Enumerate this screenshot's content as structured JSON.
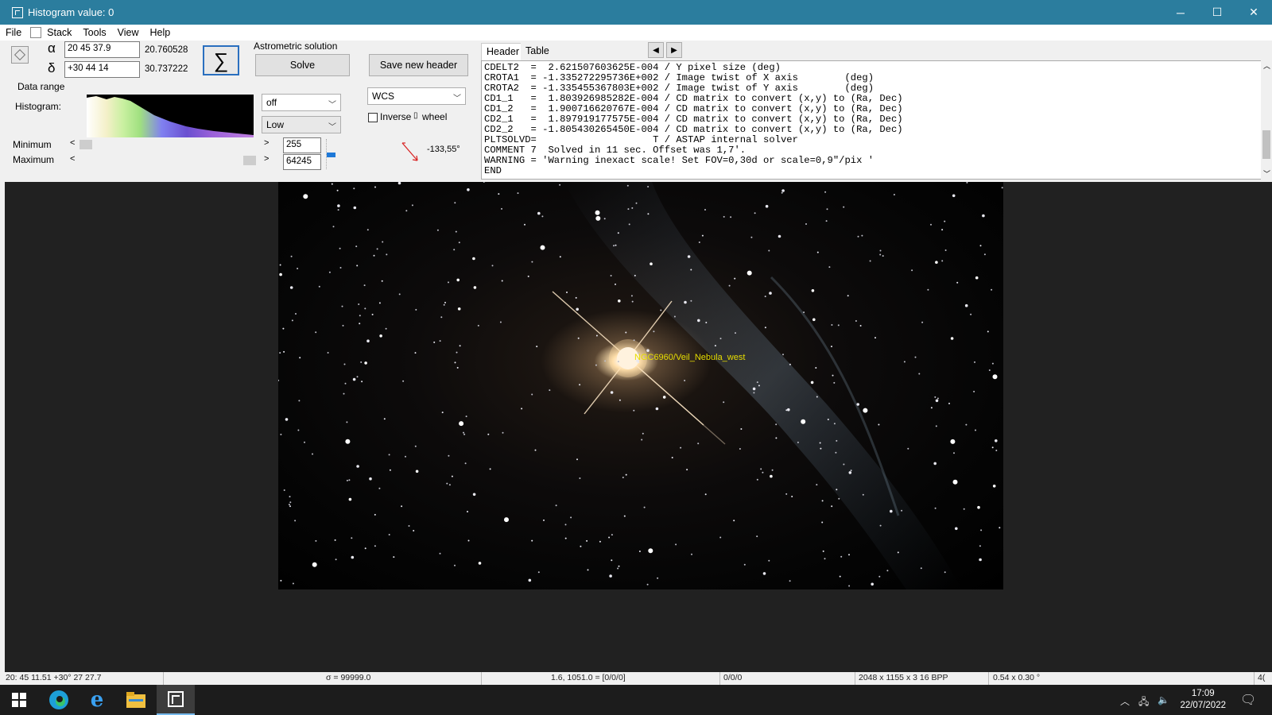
{
  "window": {
    "title": "Histogram value: 0",
    "minimize": "─",
    "maximize": "☐",
    "close": "✕"
  },
  "menu": {
    "file": "File",
    "stack": "Stack",
    "tools": "Tools",
    "view": "View",
    "help": "Help"
  },
  "coords": {
    "alpha_symbol": "α",
    "delta_symbol": "δ",
    "ra_input": "20 45 37.9",
    "dec_input": "+30 44 14",
    "ra_decimal": "20.760528",
    "dec_decimal": "30.737222",
    "sum_symbol": "∑"
  },
  "astrometry": {
    "group_label": "Astrometric solution",
    "solve_label": "Solve",
    "save_header_label": "Save new header"
  },
  "data_range": {
    "label": "Data range",
    "histogram_label": "Histogram:",
    "stretch_select": "off",
    "level_select": "Low",
    "minimum_label": "Minimum",
    "maximum_label": "Maximum",
    "minimum_value": "255",
    "maximum_value": "64245",
    "minimum_slider_fraction": 0.0,
    "maximum_slider_fraction": 1.0
  },
  "overlay": {
    "select": "WCS",
    "inverse_label": "Inverse",
    "wheel_label": "wheel",
    "inverse_checked": false,
    "angle": "-133,55°"
  },
  "header_panel": {
    "tab_header": "Header",
    "tab_table": "Table",
    "lines": [
      "CDELT2  =  2.621507603625E-004 / Y pixel size (deg)",
      "CROTA1  = -1.335272295736E+002 / Image twist of X axis        (deg)",
      "CROTA2  = -1.335455367803E+002 / Image twist of Y axis        (deg)",
      "CD1_1   =  1.803926985282E-004 / CD matrix to convert (x,y) to (Ra, Dec)",
      "CD1_2   =  1.900716620767E-004 / CD matrix to convert (x,y) to (Ra, Dec)",
      "CD2_1   =  1.897919177575E-004 / CD matrix to convert (x,y) to (Ra, Dec)",
      "CD2_2   = -1.805430265450E-004 / CD matrix to convert (x,y) to (Ra, Dec)",
      "PLTSOLVD=                    T / ASTAP internal solver",
      "COMMENT 7  Solved in 11 sec. Offset was 1,7'.",
      "WARNING = 'Warning inexact scale! Set FOV=0,30d or scale=0,9\"/pix '",
      "END"
    ]
  },
  "image": {
    "object_label": "NGC6960/Veil_Nebula_west"
  },
  "statusbar": {
    "position": "20: 45  11.51  +30° 27  27.7",
    "sigma": "σ = 99999.0",
    "pixel": "1.6, 1051.0 = [0/0/0]",
    "rgb": "0/0/0",
    "dimensions": "2048 x 1155 x 3   16 BPP",
    "fov": "0.54 x 0.30 °",
    "last": "4("
  },
  "taskbar": {
    "time": "17:09",
    "date": "22/07/2022"
  },
  "colors": {
    "titlebar": "#2b7d9e",
    "viewer_bg": "#212121",
    "label_yellow": "#e6dd00",
    "taskbar": "#1c1c1c"
  }
}
